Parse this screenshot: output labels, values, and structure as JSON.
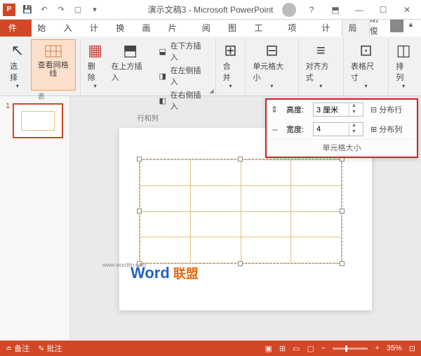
{
  "title": "演示文稿3 - Microsoft PowerPoint",
  "user_name": "胡俊",
  "tabs": {
    "file": "文件",
    "home": "开始",
    "insert": "插入",
    "design": "设计",
    "transitions": "切换",
    "animations": "动画",
    "slideshow": "幻灯片",
    "review": "审阅",
    "view": "视图",
    "developer": "开发工",
    "addins": "加载项",
    "tabledesign": "设计",
    "layout": "布局"
  },
  "ribbon": {
    "select": "选择",
    "view_gridlines": "查看网格线",
    "table_group": "表",
    "delete": "删除",
    "insert_above": "在上方插入",
    "insert_below": "在下方插入",
    "insert_left": "在左侧插入",
    "insert_right": "在右侧插入",
    "rows_cols_group": "行和列",
    "merge": "合并",
    "cell_size": "单元格大小",
    "alignment": "对齐方式",
    "table_size": "表格尺寸",
    "arrange": "排列"
  },
  "panel": {
    "height_label": "高度:",
    "height_value": "3 厘米",
    "width_label": "宽度:",
    "width_value": "4",
    "distribute_rows": "分布行",
    "distribute_cols": "分布列",
    "title": "单元格大小"
  },
  "thumbnail": {
    "num": "1"
  },
  "watermark": {
    "brand1": "Word",
    "brand2": " 联盟",
    "url": "www.wordlm.com"
  },
  "status": {
    "notes": "备注",
    "comments": "批注",
    "zoom": "35%"
  }
}
